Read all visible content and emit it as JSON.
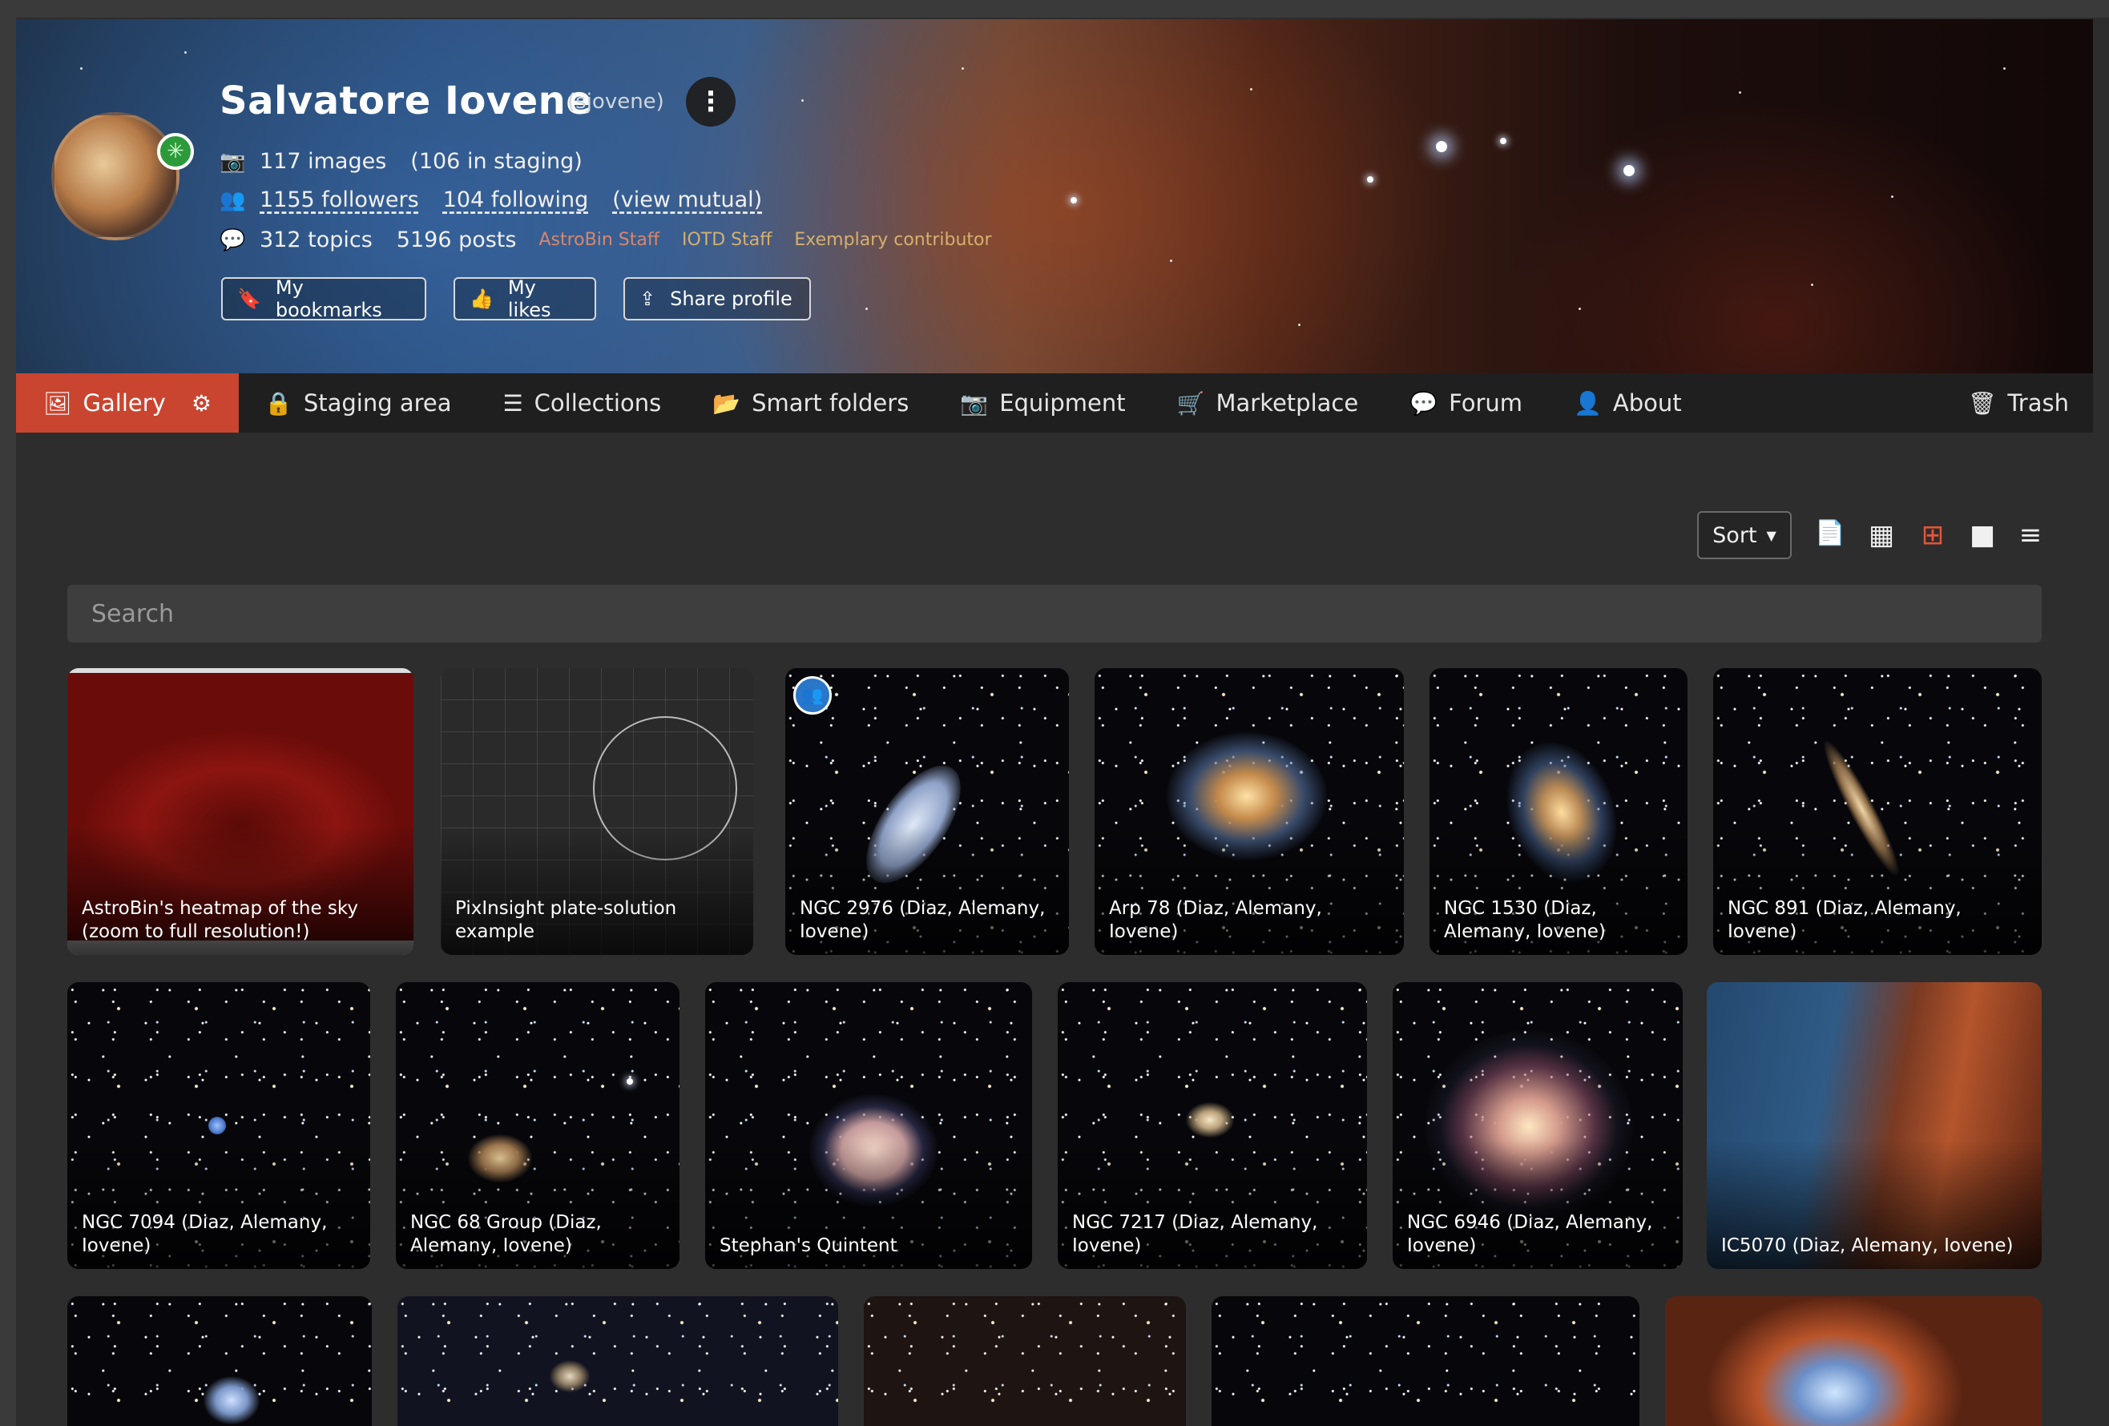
{
  "profile": {
    "name": "Salvatore Iovene",
    "username": "(sjovene)",
    "images": "117 images",
    "staging": "(106 in staging)",
    "followers": "1155 followers",
    "following": "104 following",
    "view_mutual": "(view mutual)",
    "topics": "312 topics",
    "posts": "5196 posts",
    "badges": [
      "AstroBin Staff",
      "IOTD Staff",
      "Exemplary contributor"
    ],
    "badge_colors": [
      "#d7876b",
      "#d5b06d",
      "#d5b06d"
    ],
    "buttons": {
      "bookmarks": "My bookmarks",
      "likes": "My likes",
      "share": "Share profile"
    }
  },
  "nav": {
    "gallery": "Gallery",
    "staging": "Staging area",
    "collections": "Collections",
    "smart_folders": "Smart folders",
    "equipment": "Equipment",
    "marketplace": "Marketplace",
    "forum": "Forum",
    "about": "About",
    "trash": "Trash",
    "active_color": "#c9452f"
  },
  "toolbar": {
    "sort": "Sort",
    "views": [
      "csv-export-icon",
      "grid-small-icon",
      "grid-large-icon",
      "single-icon",
      "list-icon"
    ],
    "active_view": "grid-large-icon"
  },
  "search": {
    "placeholder": "Search"
  },
  "gallery": [
    "AstroBin's heatmap of the sky (zoom to full resolution!)",
    "PixInsight plate-solution example",
    "NGC 2976 (Diaz, Alemany, Iovene)",
    "Arp 78 (Diaz, Alemany, Iovene)",
    "NGC 1530 (Diaz, Alemany, Iovene)",
    "NGC 891 (Diaz, Alemany, Iovene)",
    "NGC 7094 (Diaz, Alemany, Iovene)",
    "NGC 68 Group (Diaz, Alemany, Iovene)",
    "Stephan's Quintent",
    "NGC 7217 (Diaz, Alemany, Iovene)",
    "NGC 6946 (Diaz, Alemany, Iovene)",
    "IC5070 (Diaz, Alemany, Iovene)"
  ]
}
